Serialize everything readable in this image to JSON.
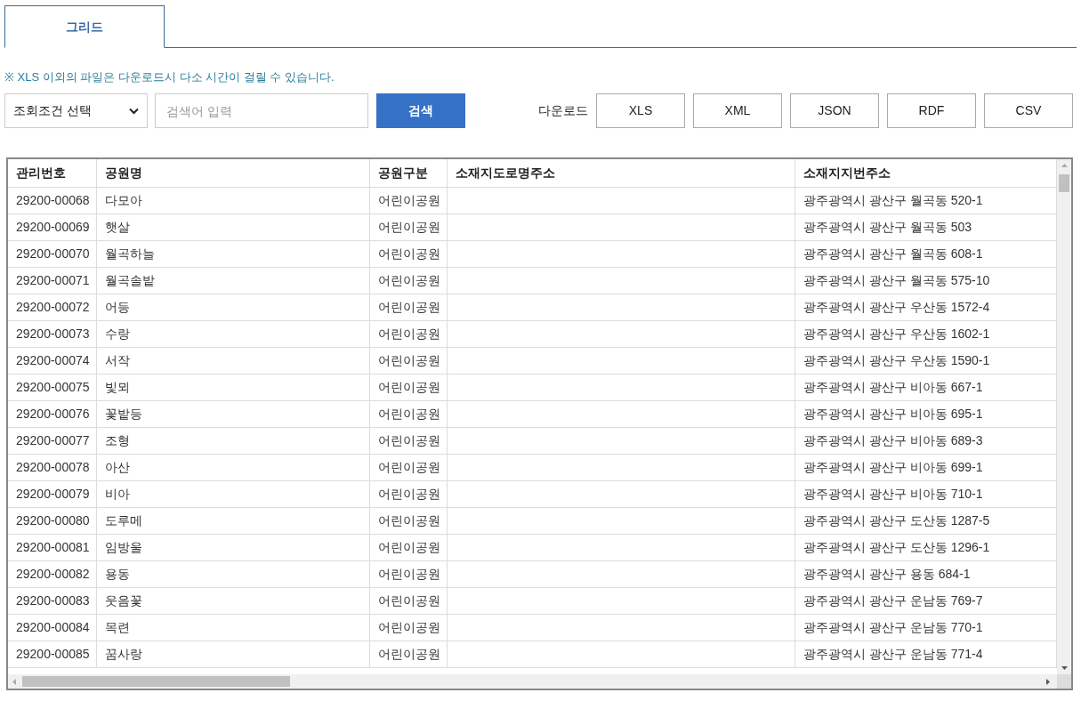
{
  "tabs": [
    {
      "label": "그리드",
      "selected": true
    }
  ],
  "notice": "※ XLS 이외의 파일은 다운로드시 다소 시간이 걸릴 수 있습니다.",
  "search": {
    "condition": "조회조건 선택",
    "placeholder": "검색어 입력",
    "button": "검색"
  },
  "download": {
    "label": "다운로드",
    "formats": [
      "XLS",
      "XML",
      "JSON",
      "RDF",
      "CSV"
    ]
  },
  "table": {
    "columns": [
      "관리번호",
      "공원명",
      "공원구분",
      "소재지도로명주소",
      "소재지지번주소"
    ],
    "rows": [
      {
        "id": "29200-00068",
        "name": "다모아",
        "type": "어린이공원",
        "lot_address": "광주광역시 광산구 월곡동 520-1"
      },
      {
        "id": "29200-00069",
        "name": "햇살",
        "type": "어린이공원",
        "lot_address": "광주광역시 광산구 월곡동 503"
      },
      {
        "id": "29200-00070",
        "name": "월곡하늘",
        "type": "어린이공원",
        "lot_address": "광주광역시 광산구 월곡동 608-1"
      },
      {
        "id": "29200-00071",
        "name": "월곡솔밭",
        "type": "어린이공원",
        "lot_address": "광주광역시 광산구 월곡동 575-10"
      },
      {
        "id": "29200-00072",
        "name": "어등",
        "type": "어린이공원",
        "lot_address": "광주광역시 광산구 우산동 1572-4"
      },
      {
        "id": "29200-00073",
        "name": "수랑",
        "type": "어린이공원",
        "lot_address": "광주광역시 광산구 우산동 1602-1"
      },
      {
        "id": "29200-00074",
        "name": "서작",
        "type": "어린이공원",
        "lot_address": "광주광역시 광산구 우산동 1590-1"
      },
      {
        "id": "29200-00075",
        "name": "빛뫼",
        "type": "어린이공원",
        "lot_address": "광주광역시 광산구 비아동 667-1"
      },
      {
        "id": "29200-00076",
        "name": "꽃밭등",
        "type": "어린이공원",
        "lot_address": "광주광역시 광산구 비아동 695-1"
      },
      {
        "id": "29200-00077",
        "name": "조형",
        "type": "어린이공원",
        "lot_address": "광주광역시 광산구 비아동 689-3"
      },
      {
        "id": "29200-00078",
        "name": "아산",
        "type": "어린이공원",
        "lot_address": "광주광역시 광산구 비아동 699-1"
      },
      {
        "id": "29200-00079",
        "name": "비아",
        "type": "어린이공원",
        "lot_address": "광주광역시 광산구 비아동 710-1"
      },
      {
        "id": "29200-00080",
        "name": "도루메",
        "type": "어린이공원",
        "lot_address": "광주광역시 광산구 도산동 1287-5"
      },
      {
        "id": "29200-00081",
        "name": "임방울",
        "type": "어린이공원",
        "lot_address": "광주광역시 광산구 도산동 1296-1"
      },
      {
        "id": "29200-00082",
        "name": "용동",
        "type": "어린이공원",
        "lot_address": "광주광역시 광산구 용동 684-1"
      },
      {
        "id": "29200-00083",
        "name": "웃음꽃",
        "type": "어린이공원",
        "lot_address": "광주광역시 광산구 운남동 769-7"
      },
      {
        "id": "29200-00084",
        "name": "목련",
        "type": "어린이공원",
        "lot_address": "광주광역시 광산구 운남동 770-1"
      },
      {
        "id": "29200-00085",
        "name": "꿈사랑",
        "type": "어린이공원",
        "lot_address": "광주광역시 광산구 운남동 771-4"
      }
    ]
  }
}
